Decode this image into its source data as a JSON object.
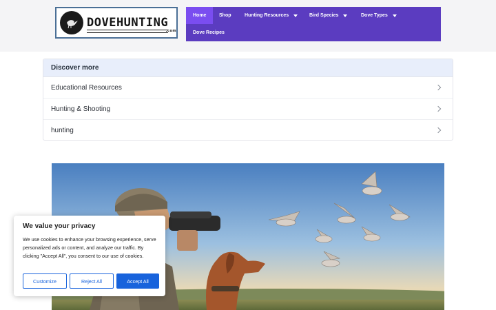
{
  "logo": {
    "text": "DOVEHUNTING",
    "suffix": ".com"
  },
  "nav": {
    "items": [
      {
        "label": "Home",
        "active": true,
        "has_caret": false
      },
      {
        "label": "Shop",
        "active": false,
        "has_caret": false
      },
      {
        "label": "Hunting Resources",
        "active": false,
        "has_caret": true
      },
      {
        "label": "Bird Species",
        "active": false,
        "has_caret": true
      },
      {
        "label": "Dove Types",
        "active": false,
        "has_caret": true
      },
      {
        "label": "Dove Recipes",
        "active": false,
        "has_caret": false
      }
    ]
  },
  "discover": {
    "title": "Discover more",
    "items": [
      {
        "label": "Educational Resources"
      },
      {
        "label": "Hunting & Shooting"
      },
      {
        "label": "hunting"
      }
    ]
  },
  "cookie": {
    "title": "We value your privacy",
    "body": "We use cookies to enhance your browsing experience, serve personalized ads or content, and analyze our traffic. By clicking \"Accept All\", you consent to our use of cookies.",
    "customize_label": "Customize",
    "reject_label": "Reject All",
    "accept_label": "Accept All"
  },
  "colors": {
    "nav_bg": "#5b3cc0",
    "nav_active": "#7a4df0",
    "discover_header_bg": "#e8eefb",
    "cookie_accent": "#1863dc"
  }
}
